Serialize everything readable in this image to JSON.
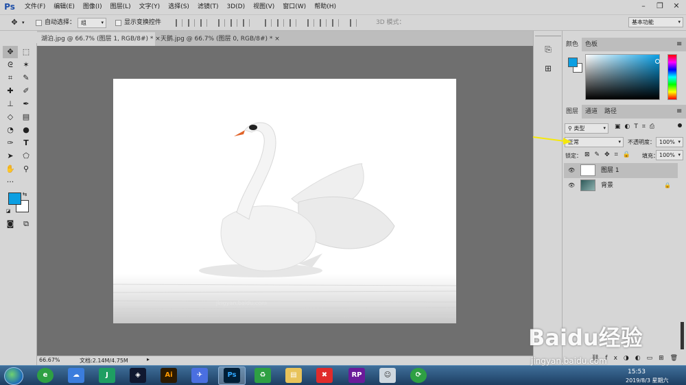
{
  "app": {
    "logo": "Ps"
  },
  "menu": [
    "文件(F)",
    "编辑(E)",
    "图像(I)",
    "图层(L)",
    "文字(Y)",
    "选择(S)",
    "滤镜(T)",
    "3D(D)",
    "视图(V)",
    "窗口(W)",
    "帮助(H)"
  ],
  "options_bar": {
    "auto_select_label": "自动选择：",
    "auto_select_value": "组",
    "show_transform_label": "显示变换控件",
    "mode_3d_label": "3D 模式：",
    "workspace": "基本功能"
  },
  "doc_tabs": [
    {
      "label": "湖泊.jpg @ 66.7% (图层 1, RGB/8#) *",
      "close": "×"
    },
    {
      "label": "天鹅.jpg @ 66.7% (图层 0, RGB/8#) *",
      "close": "×"
    }
  ],
  "status": {
    "zoom": "66.67%",
    "doc": "文档:2.14M/4.75M"
  },
  "color_panel": {
    "tabs": [
      "颜色",
      "色板"
    ],
    "fg": "#0c9fe2",
    "bg": "#ffffff"
  },
  "layers_panel": {
    "tabs": [
      "图层",
      "通道",
      "路径"
    ],
    "filter_label": "类型",
    "blend_mode": "正常",
    "opacity_label": "不透明度：",
    "opacity_value": "100%",
    "lock_label": "锁定：",
    "fill_label": "填充：",
    "fill_value": "100%",
    "layers": [
      {
        "name": "图层 1",
        "selected": true
      },
      {
        "name": "背景",
        "locked": true
      }
    ]
  },
  "taskbar": {
    "apps": [
      "Ai",
      "Ps",
      "RP"
    ],
    "time": "15:53",
    "date": "2019/8/3 星期六"
  },
  "watermark": {
    "brand": "Baidu经验",
    "url": "jingyan.baidu.com"
  },
  "image_watermark": "jingyan.baidu.com",
  "colors": {
    "accent": "#0c9fe2",
    "arrow": "#f5e80a"
  }
}
